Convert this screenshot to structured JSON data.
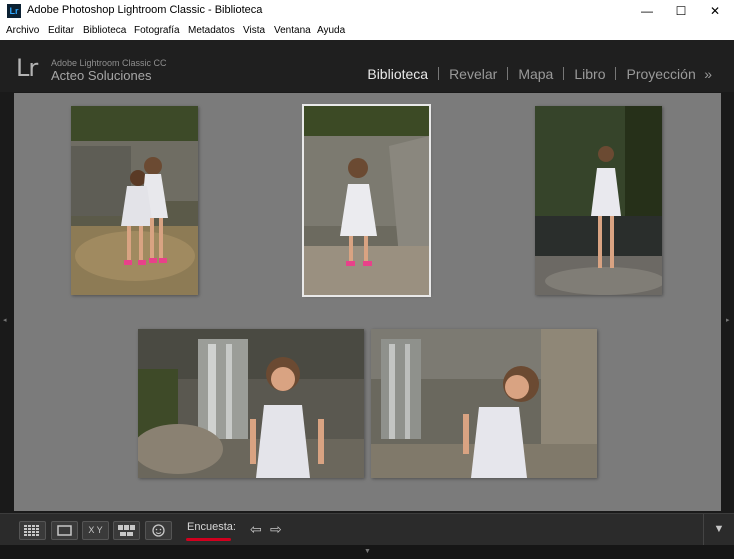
{
  "window": {
    "title": "Adobe Photoshop Lightroom Classic - Biblioteca",
    "app_icon": "Lr",
    "controls": {
      "minimize": "—",
      "maximize": "☐",
      "close": "✕"
    }
  },
  "menu": [
    "Archivo",
    "Editar",
    "Biblioteca",
    "Fotografía",
    "Metadatos",
    "Vista",
    "Ventana",
    "Ayuda"
  ],
  "identity": {
    "logo": "Lr",
    "product": "Adobe Lightroom Classic CC",
    "name": "Acteo Soluciones"
  },
  "modules": [
    {
      "label": "Biblioteca",
      "active": true
    },
    {
      "label": "Revelar",
      "active": false
    },
    {
      "label": "Mapa",
      "active": false
    },
    {
      "label": "Libro",
      "active": false
    },
    {
      "label": "Proyección",
      "active": false
    }
  ],
  "modules_more": "»",
  "toolbar": {
    "survey_label": "Encuesta:",
    "prev_icon": "arrow-left-icon",
    "next_icon": "arrow-right-icon",
    "xy_label": "X Y",
    "menu_icon": "chevron-down-icon"
  },
  "colors": {
    "accent_underline": "#d2001e",
    "grid_bg": "#7b7b7b"
  }
}
